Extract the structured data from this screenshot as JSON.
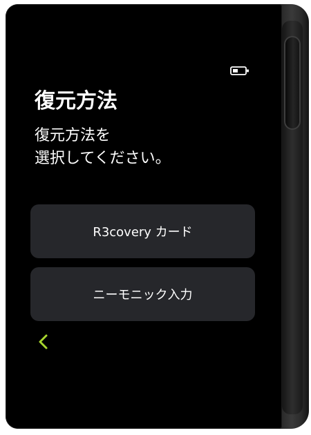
{
  "screen": {
    "title": "復元方法",
    "instruction_line1": "復元方法を",
    "instruction_line2": "選択してください。"
  },
  "options": [
    {
      "label": "R3covery カード"
    },
    {
      "label": "ニーモニック入力"
    }
  ],
  "icons": {
    "battery": "battery-icon",
    "back": "chevron-left-icon"
  },
  "colors": {
    "background": "#000000",
    "button": "#26272b",
    "text": "#ffffff",
    "accent": "#a8d62e"
  }
}
